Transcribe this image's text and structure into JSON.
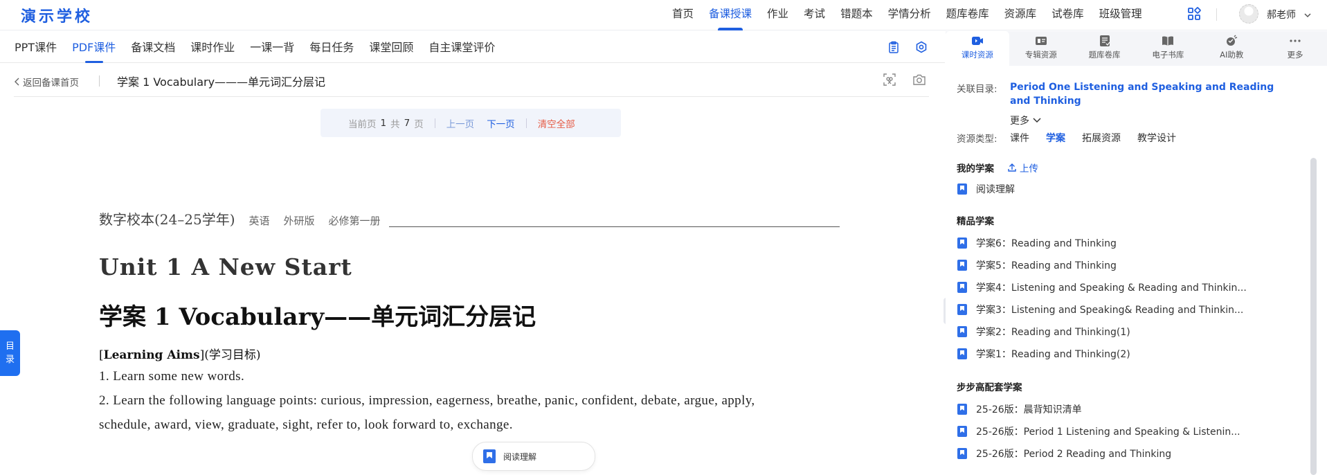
{
  "app": {
    "logo": "演示学校",
    "nav": [
      {
        "label": "首页",
        "active": false
      },
      {
        "label": "备课授课",
        "active": true
      },
      {
        "label": "作业",
        "active": false
      },
      {
        "label": "考试",
        "active": false
      },
      {
        "label": "错题本",
        "active": false
      },
      {
        "label": "学情分析",
        "active": false
      },
      {
        "label": "题库卷库",
        "active": false
      },
      {
        "label": "资源库",
        "active": false
      },
      {
        "label": "试卷库",
        "active": false
      },
      {
        "label": "班级管理",
        "active": false
      }
    ],
    "user": "郝老师",
    "accent": "#1f5fe0"
  },
  "tabs": [
    {
      "label": "PPT课件",
      "active": false
    },
    {
      "label": "PDF课件",
      "active": true
    },
    {
      "label": "备课文档",
      "active": false
    },
    {
      "label": "课时作业",
      "active": false
    },
    {
      "label": "一课一背",
      "active": false
    },
    {
      "label": "每日任务",
      "active": false
    },
    {
      "label": "课堂回顾",
      "active": false
    },
    {
      "label": "自主课堂评价",
      "active": false
    }
  ],
  "breadcrumb": {
    "back": "返回备课首页",
    "title": "学案 1 Vocabulary———单元词汇分层记"
  },
  "pager": {
    "current_label": "当前页",
    "current": "1",
    "total_label": "共",
    "total": "7",
    "page_unit": "页",
    "prev": "上一页",
    "next": "下一页",
    "clear": "清空全部"
  },
  "document": {
    "series": "数字校本(24–25学年)",
    "subject": "英语",
    "publisher": "外研版",
    "volume": "必修第一册",
    "unit_title": "Unit 1 A New Start",
    "lesson_title": "学案 1 Vocabulary——单元词汇分层记",
    "aims_label": "Learning Aims",
    "aims_cn": "(学习目标)",
    "aims": [
      "1. Learn some new words.",
      "2. Learn the following language points: curious, impression, eagerness, breathe, panic, confident, debate, argue, apply,",
      "schedule, award, view, graduate, sight, refer to, look forward to, exchange."
    ]
  },
  "floating_card": {
    "label": "阅读理解"
  },
  "toc_tab": {
    "line1": "目",
    "line2": "录"
  },
  "right_panel": {
    "tabs": [
      {
        "label": "课时资源",
        "icon": "video-icon",
        "active": true
      },
      {
        "label": "专辑资源",
        "icon": "album-icon",
        "active": false
      },
      {
        "label": "题库卷库",
        "icon": "question-bank-icon",
        "active": false
      },
      {
        "label": "电子书库",
        "icon": "book-icon",
        "active": false
      },
      {
        "label": "AI助教",
        "icon": "ai-icon",
        "active": false
      },
      {
        "label": "更多",
        "icon": "more-icon",
        "active": false
      }
    ],
    "catalog_label": "关联目录:",
    "catalog_value": "Period One Listening and Speaking and Reading and Thinking",
    "more": "更多",
    "resource_type_label": "资源类型:",
    "resource_types": [
      {
        "label": "课件",
        "active": false
      },
      {
        "label": "学案",
        "active": true
      },
      {
        "label": "拓展资源",
        "active": false
      },
      {
        "label": "教学设计",
        "active": false
      }
    ],
    "my_section": "我的学案",
    "upload": "上传",
    "my_items": [
      "阅读理解"
    ],
    "featured_section": "精品学案",
    "featured_items": [
      "学案6：Reading and Thinking",
      "学案5：Reading and Thinking",
      "学案4：Listening and Speaking & Reading and Thinkin...",
      "学案3：Listening and Speaking& Reading and Thinkin...",
      "学案2：Reading and Thinking(1)",
      "学案1：Reading and Thinking(2)"
    ],
    "bubu_section": "步步高配套学案",
    "bubu_items": [
      "25-26版：晨背知识清单",
      "25-26版：Period 1   Listening and Speaking & Listenin...",
      "25-26版：Period 2   Reading and Thinking"
    ]
  }
}
